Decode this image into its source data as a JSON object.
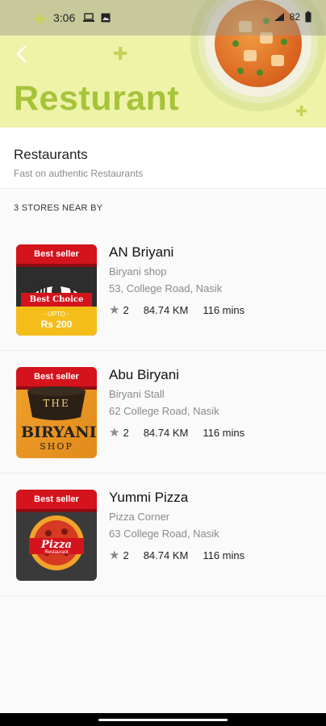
{
  "status": {
    "time": "3:06",
    "battery": "82"
  },
  "header": {
    "back_label": "‹",
    "title": "Resturant"
  },
  "section": {
    "title": "Restaurants",
    "subtitle": "Fast on authentic Restaurants"
  },
  "near_label": "3 STORES NEAR BY",
  "colors": {
    "accent": "#a6c33a",
    "header_bg": "#eef3a8",
    "badge_red": "#d3141d",
    "offer_yellow": "#f5bd1a"
  },
  "stores": [
    {
      "name": "AN Briyani",
      "category": "Biryani shop",
      "address": "53, College Road, Nasik",
      "rating": "2",
      "distance": "84.74 KM",
      "time": "116 mins",
      "badge": "Best seller",
      "logo_text": "Best Choice",
      "offer_label": "- UPTO -",
      "offer_amount": "Rs 200"
    },
    {
      "name": "Abu Biryani",
      "category": "Biryani Stall",
      "address": "62 College Road, Nasik",
      "rating": "2",
      "distance": "84.74 KM",
      "time": "116 mins",
      "badge": "Best seller",
      "logo_line1": "THE",
      "logo_line2": "BIRYANI",
      "logo_line3": "SHOP"
    },
    {
      "name": "Yummi Pizza",
      "category": "Pizza Corner",
      "address": "63 College Road, Nasik",
      "rating": "2",
      "distance": "84.74 KM",
      "time": "116 mins",
      "badge": "Best seller",
      "logo_line1": "Pizza",
      "logo_line2": "Restaurant"
    }
  ]
}
